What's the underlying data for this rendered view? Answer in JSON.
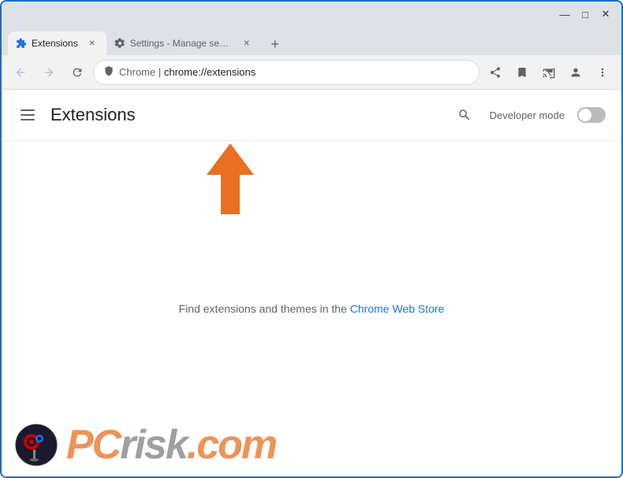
{
  "window": {
    "controls": {
      "minimize": "—",
      "maximize": "□",
      "close": "✕"
    }
  },
  "tabs": [
    {
      "id": "extensions",
      "label": "Extensions",
      "favicon": "puzzle",
      "active": true,
      "url": "chrome://extensions"
    },
    {
      "id": "settings",
      "label": "Settings - Manage search engine",
      "favicon": "gear",
      "active": false,
      "url": "chrome://settings/searchEngines"
    }
  ],
  "new_tab_button": "+",
  "nav": {
    "back_disabled": true,
    "forward_disabled": true,
    "reload": "↺",
    "address": {
      "site_name": "Chrome",
      "url": "chrome://extensions"
    },
    "right_icons": [
      "share",
      "star",
      "cast",
      "profile",
      "menu"
    ]
  },
  "extensions_page": {
    "title": "Extensions",
    "hamburger_label": "menu",
    "search_label": "search",
    "developer_mode_label": "Developer mode",
    "developer_mode_enabled": false,
    "find_text_prefix": "Find extensions and themes in the ",
    "chrome_web_store_link": "Chrome Web Store"
  },
  "watermark": {
    "logo_alt": "PCrisk logo",
    "pc_text": "PC",
    "risk_text": "risk",
    "dot_com_text": ".com"
  }
}
